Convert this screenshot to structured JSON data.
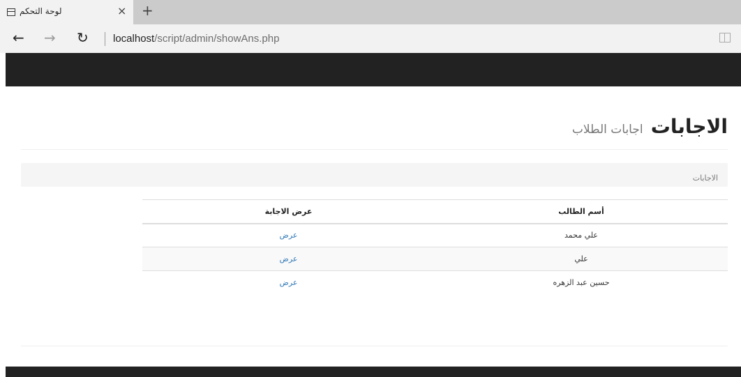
{
  "browser": {
    "tab_title": "لوحة التحكم",
    "tab_close": "×",
    "new_tab": "+",
    "back": "←",
    "forward": "→",
    "refresh": "↻",
    "url_host": "localhost",
    "url_path": "/script/admin/showAns.php"
  },
  "page": {
    "title": "الاجابات",
    "subtitle": "اجابات الطلاب",
    "breadcrumb": "الاجابات"
  },
  "table": {
    "headers": [
      "أسم الطالب",
      "عرض الاجابة"
    ],
    "rows": [
      {
        "name": "علي محمد",
        "action": "عرض"
      },
      {
        "name": "علي",
        "action": "عرض"
      },
      {
        "name": "حسين عبد الزهره",
        "action": "عرض"
      }
    ]
  },
  "colors": {
    "navbar": "#222222",
    "link": "#337ab7",
    "tabbar": "#cbcbcb"
  }
}
